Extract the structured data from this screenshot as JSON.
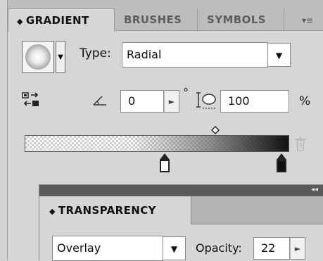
{
  "gradient_panel": {
    "tabs": [
      {
        "label": "GRADIENT",
        "icon": "diamond-collapse-icon"
      },
      {
        "label": "BRUSHES"
      },
      {
        "label": "SYMBOLS"
      }
    ],
    "menu_glyph": "▾≡",
    "type_label": "Type:",
    "type_value": "Radial",
    "angle_value": "0",
    "degree_symbol": "°",
    "aspect_value": "100",
    "percent_symbol": "%"
  },
  "transparency_panel": {
    "tab_label": "TRANSPARENCY",
    "collapse_glyph": "◂◂",
    "blend_mode": "Overlay",
    "opacity_label": "Opacity:",
    "opacity_value": "22"
  }
}
